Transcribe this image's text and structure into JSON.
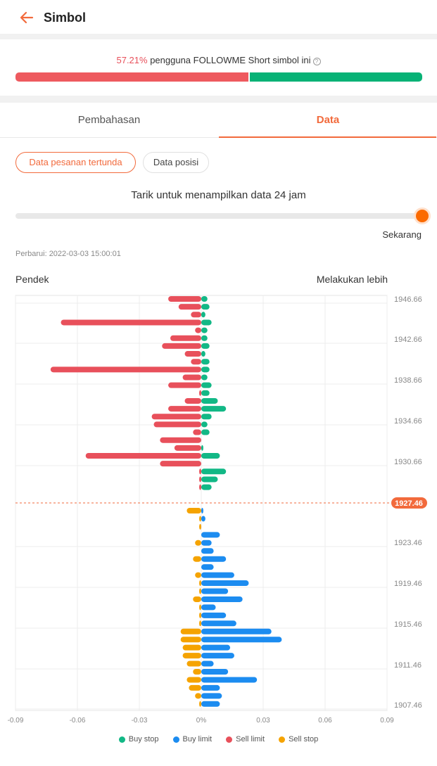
{
  "header": {
    "title": "Simbol"
  },
  "sentiment": {
    "percent": "57.21%",
    "text": " pengguna FOLLOWME Short simbol ini",
    "short_ratio": 0.5721,
    "short_color": "#ee5a5f",
    "long_color": "#07b276"
  },
  "tabs": [
    {
      "label": "Pembahasan",
      "active": false
    },
    {
      "label": "Data",
      "active": true
    }
  ],
  "pills": {
    "pending": "Data pesanan tertunda",
    "position": "Data posisi"
  },
  "slider": {
    "label": "Tarik untuk menampilkan data 24 jam",
    "end_label": "Sekarang",
    "value": 1.0
  },
  "updated": "Perbarui: 2022-03-03 15:00:01",
  "side_labels": {
    "short": "Pendek",
    "long": "Melakukan lebih"
  },
  "legend": [
    {
      "label": "Buy stop",
      "color": "#12b886"
    },
    {
      "label": "Buy limit",
      "color": "#1c8cf0"
    },
    {
      "label": "Sell limit",
      "color": "#e8505b"
    },
    {
      "label": "Sell stop",
      "color": "#f5a300"
    }
  ],
  "chart_data": {
    "type": "bar",
    "orientation": "horizontal-diverging",
    "xlim": [
      -0.09,
      0.09
    ],
    "x_ticks": [
      "-0.09",
      "-0.06",
      "-0.03",
      "0%",
      "0.03",
      "0.06",
      "0.09"
    ],
    "y_ticks": [
      "1946.66",
      "1942.66",
      "1938.66",
      "1934.66",
      "1930.66",
      "1923.46",
      "1919.46",
      "1915.46",
      "1911.46",
      "1907.46"
    ],
    "current_price": "1927.46",
    "upper_rows": [
      {
        "sell_limit": -0.016,
        "buy_stop": 0.003
      },
      {
        "sell_limit": -0.011,
        "buy_stop": 0.004
      },
      {
        "sell_limit": -0.005,
        "buy_stop": 0.002
      },
      {
        "sell_limit": -0.068,
        "buy_stop": 0.005
      },
      {
        "sell_limit": -0.003,
        "buy_stop": 0.003
      },
      {
        "sell_limit": -0.015,
        "buy_stop": 0.003
      },
      {
        "sell_limit": -0.019,
        "buy_stop": 0.004
      },
      {
        "sell_limit": -0.008,
        "buy_stop": 0.002
      },
      {
        "sell_limit": -0.005,
        "buy_stop": 0.004
      },
      {
        "sell_limit": -0.073,
        "buy_stop": 0.004
      },
      {
        "sell_limit": -0.009,
        "buy_stop": 0.003
      },
      {
        "sell_limit": -0.016,
        "buy_stop": 0.005
      },
      {
        "sell_limit": -0.001,
        "buy_stop": 0.004
      },
      {
        "sell_limit": -0.008,
        "buy_stop": 0.008
      },
      {
        "sell_limit": -0.016,
        "buy_stop": 0.012
      },
      {
        "sell_limit": -0.024,
        "buy_stop": 0.005
      },
      {
        "sell_limit": -0.023,
        "buy_stop": 0.003
      },
      {
        "sell_limit": -0.004,
        "buy_stop": 0.004
      },
      {
        "sell_limit": -0.02,
        "buy_stop": 0.0
      },
      {
        "sell_limit": -0.013,
        "buy_stop": 0.001
      },
      {
        "sell_limit": -0.056,
        "buy_stop": 0.009
      },
      {
        "sell_limit": -0.02,
        "buy_stop": 0.0
      },
      {
        "sell_limit": -0.001,
        "buy_stop": 0.012
      },
      {
        "sell_limit": -0.001,
        "buy_stop": 0.008
      },
      {
        "sell_limit": -0.001,
        "buy_stop": 0.005
      }
    ],
    "lower_rows": [
      {
        "sell_stop": -0.007,
        "buy_limit": 0.001
      },
      {
        "sell_stop": -0.001,
        "buy_limit": 0.002
      },
      {
        "sell_stop": -0.001,
        "buy_limit": 0.0
      },
      {
        "sell_stop": 0.0,
        "buy_limit": 0.009
      },
      {
        "sell_stop": -0.003,
        "buy_limit": 0.005
      },
      {
        "sell_stop": 0.0,
        "buy_limit": 0.006
      },
      {
        "sell_stop": -0.004,
        "buy_limit": 0.012
      },
      {
        "sell_stop": 0.0,
        "buy_limit": 0.006
      },
      {
        "sell_stop": -0.003,
        "buy_limit": 0.016
      },
      {
        "sell_stop": -0.001,
        "buy_limit": 0.023
      },
      {
        "sell_stop": -0.001,
        "buy_limit": 0.013
      },
      {
        "sell_stop": -0.004,
        "buy_limit": 0.02
      },
      {
        "sell_stop": -0.001,
        "buy_limit": 0.007
      },
      {
        "sell_stop": -0.001,
        "buy_limit": 0.012
      },
      {
        "sell_stop": -0.001,
        "buy_limit": 0.017
      },
      {
        "sell_stop": -0.01,
        "buy_limit": 0.034
      },
      {
        "sell_stop": -0.01,
        "buy_limit": 0.039
      },
      {
        "sell_stop": -0.009,
        "buy_limit": 0.014
      },
      {
        "sell_stop": -0.009,
        "buy_limit": 0.016
      },
      {
        "sell_stop": -0.007,
        "buy_limit": 0.006
      },
      {
        "sell_stop": -0.004,
        "buy_limit": 0.013
      },
      {
        "sell_stop": -0.007,
        "buy_limit": 0.027
      },
      {
        "sell_stop": -0.006,
        "buy_limit": 0.009
      },
      {
        "sell_stop": -0.003,
        "buy_limit": 0.01
      },
      {
        "sell_stop": -0.001,
        "buy_limit": 0.009
      }
    ]
  }
}
